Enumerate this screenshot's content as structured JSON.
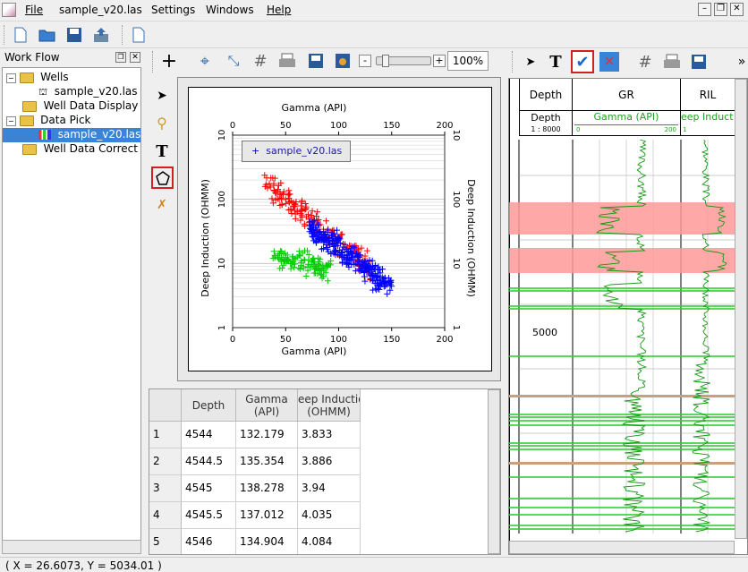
{
  "title_menu": {
    "file": "File",
    "filename": "sample_v20.las",
    "settings": "Settings",
    "windows": "Windows",
    "help": "Help"
  },
  "workflow": {
    "title": "Work Flow",
    "items": [
      {
        "label": "Wells"
      },
      {
        "label": "sample_v20.las"
      },
      {
        "label": "Well Data Display"
      },
      {
        "label": "Data Pick"
      },
      {
        "label": "sample_v20.las"
      },
      {
        "label": "Well Data Correct"
      }
    ]
  },
  "toolbar": {
    "zoom_value": "100%",
    "zoom_minus": "-",
    "zoom_plus": "+"
  },
  "crossplot": {
    "title_top": "Gamma (API)",
    "title_bottom": "Gamma (API)",
    "ylabel_left": "Deep Induction (OHMM)",
    "ylabel_right": "Deep Induction (OHMM)",
    "legend": "sample_v20.las",
    "xticks": [
      "0",
      "50",
      "100",
      "150",
      "200"
    ],
    "yticks": [
      "10",
      "100",
      "10",
      "1"
    ]
  },
  "chart_data": {
    "type": "scatter",
    "xlabel": "Gamma (API)",
    "ylabel": "Deep Induction (OHMM)",
    "xlim": [
      0,
      200
    ],
    "ylim": [
      1,
      1000
    ],
    "yscale": "log",
    "legend": "top-left",
    "series": [
      {
        "name": "sample_v20.las",
        "color": "#0000ff",
        "points": [
          [
            132.179,
            3.833
          ],
          [
            135.354,
            3.886
          ],
          [
            138.278,
            3.94
          ],
          [
            137.012,
            4.035
          ],
          [
            134.904,
            4.084
          ]
        ]
      }
    ],
    "clusters": [
      {
        "color": "#ff0000"
      },
      {
        "color": "#00cc00"
      },
      {
        "color": "#0000ff"
      }
    ]
  },
  "table": {
    "columns": [
      "Depth",
      "Gamma\n(API)",
      "eep Inductio\n(OHMM)"
    ],
    "col1": "Depth",
    "col2a": "Gamma",
    "col2b": "(API)",
    "col3a": "eep Inductio",
    "col3b": "(OHMM)",
    "rows": [
      {
        "idx": "1",
        "depth": "4544",
        "gamma": "132.179",
        "deep": "3.833"
      },
      {
        "idx": "2",
        "depth": "4544.5",
        "gamma": "135.354",
        "deep": "3.886"
      },
      {
        "idx": "3",
        "depth": "4545",
        "gamma": "138.278",
        "deep": "3.94"
      },
      {
        "idx": "4",
        "depth": "4545.5",
        "gamma": "137.012",
        "deep": "4.035"
      },
      {
        "idx": "5",
        "depth": "4546",
        "gamma": "134.904",
        "deep": "4.084"
      }
    ]
  },
  "logview": {
    "depth_header": "Depth",
    "gr_header": "GR",
    "ril_header": "RIL",
    "depth_sub": "Depth",
    "depth_scale": "1 : 8000",
    "gr_curve": "Gamma (API)",
    "gr_min": "0",
    "gr_max": "200",
    "ril_curve": "eep Induct",
    "ril_min": "1",
    "depth_mark": "5000"
  },
  "status": {
    "coords": "( X = 26.6073, Y = 5034.01 )"
  }
}
